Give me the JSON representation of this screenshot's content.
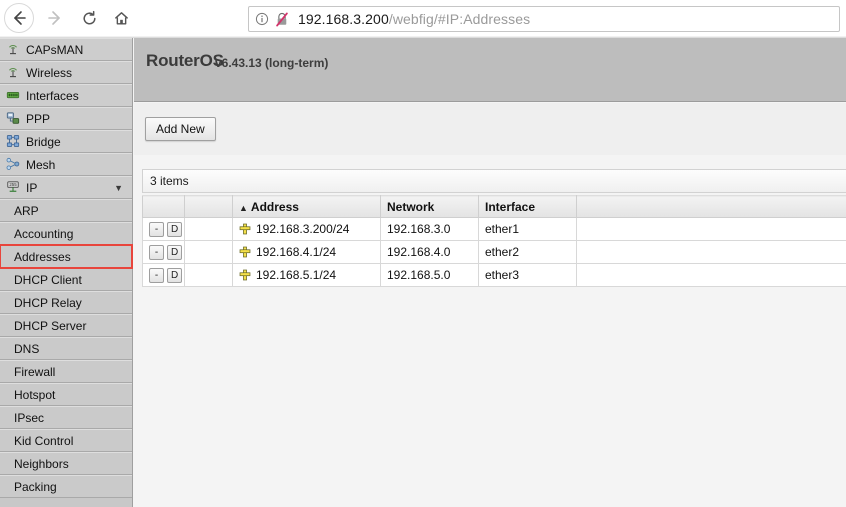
{
  "browser": {
    "nav": {
      "back_label": "Back",
      "forward_label": "Forward",
      "reload_label": "Reload",
      "home_label": "Home"
    },
    "url_host": "192.168.3.200",
    "url_path": "/webfig/#IP:Addresses",
    "url_full": "192.168.3.200/webfig/#IP:Addresses",
    "info_icon": "info-icon",
    "security_icon": "insecure-connection-icon"
  },
  "sidebar": {
    "items": [
      {
        "label": "CAPsMAN",
        "icon": "antenna-icon",
        "sub": false,
        "arrow": ""
      },
      {
        "label": "Wireless",
        "icon": "antenna-icon",
        "sub": false,
        "arrow": ""
      },
      {
        "label": "Interfaces",
        "icon": "interfaces-icon",
        "sub": false,
        "arrow": ""
      },
      {
        "label": "PPP",
        "icon": "ppp-icon",
        "sub": false,
        "arrow": ""
      },
      {
        "label": "Bridge",
        "icon": "bridge-icon",
        "sub": false,
        "arrow": ""
      },
      {
        "label": "Mesh",
        "icon": "mesh-icon",
        "sub": false,
        "arrow": ""
      },
      {
        "label": "IP",
        "icon": "ip-icon",
        "sub": false,
        "arrow": "▼"
      },
      {
        "label": "ARP",
        "icon": "",
        "sub": true,
        "arrow": ""
      },
      {
        "label": "Accounting",
        "icon": "",
        "sub": true,
        "arrow": ""
      },
      {
        "label": "Addresses",
        "icon": "",
        "sub": true,
        "arrow": ""
      },
      {
        "label": "DHCP Client",
        "icon": "",
        "sub": true,
        "arrow": ""
      },
      {
        "label": "DHCP Relay",
        "icon": "",
        "sub": true,
        "arrow": ""
      },
      {
        "label": "DHCP Server",
        "icon": "",
        "sub": true,
        "arrow": ""
      },
      {
        "label": "DNS",
        "icon": "",
        "sub": true,
        "arrow": ""
      },
      {
        "label": "Firewall",
        "icon": "",
        "sub": true,
        "arrow": ""
      },
      {
        "label": "Hotspot",
        "icon": "",
        "sub": true,
        "arrow": ""
      },
      {
        "label": "IPsec",
        "icon": "",
        "sub": true,
        "arrow": ""
      },
      {
        "label": "Kid Control",
        "icon": "",
        "sub": true,
        "arrow": ""
      },
      {
        "label": "Neighbors",
        "icon": "",
        "sub": true,
        "arrow": ""
      },
      {
        "label": "Packing",
        "icon": "",
        "sub": true,
        "arrow": ""
      }
    ],
    "highlighted_item": "Addresses",
    "highlight_color": "#e8453c"
  },
  "header": {
    "product": "RouterOS",
    "version": "v6.43.13 (long-term)"
  },
  "toolbar": {
    "add_new_label": "Add New"
  },
  "list": {
    "item_count_label": "3 items"
  },
  "table": {
    "columns": [
      "",
      "",
      "Address",
      "Network",
      "Interface",
      ""
    ],
    "sort_column": "Address",
    "sort_caret": "▲",
    "row_buttons": {
      "disable_label": "-",
      "comment_label": "D"
    },
    "rows": [
      {
        "address": "192.168.3.200/24",
        "network": "192.168.3.0",
        "interface": "ether1",
        "icon": "address-cross-icon"
      },
      {
        "address": "192.168.4.1/24",
        "network": "192.168.4.0",
        "interface": "ether2",
        "icon": "address-cross-icon"
      },
      {
        "address": "192.168.5.1/24",
        "network": "192.168.5.0",
        "interface": "ether3",
        "icon": "address-cross-icon"
      }
    ]
  },
  "colors": {
    "header_bg": "#bdbdbd",
    "sidebar_bg": "#cdcdcd",
    "address_icon": "#f5e14a",
    "highlight": "#e8453c"
  }
}
